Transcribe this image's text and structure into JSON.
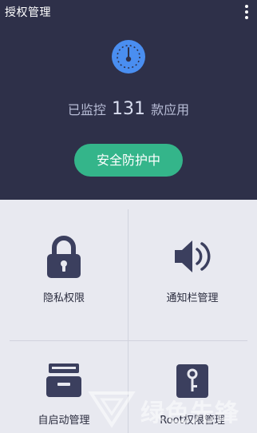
{
  "header": {
    "title": "授权管理",
    "menu_icon": "more-vert-icon"
  },
  "summary": {
    "prefix": "已监控",
    "count": "131",
    "suffix": "款应用",
    "gauge_icon": "gauge-icon",
    "gauge_color": "#4a8ef0"
  },
  "status_button": {
    "label": "安全防护中",
    "color": "#34b58a"
  },
  "tiles": [
    {
      "label": "隐私权限",
      "icon": "lock-icon"
    },
    {
      "label": "通知栏管理",
      "icon": "speaker-icon"
    },
    {
      "label": "自启动管理",
      "icon": "drawer-icon"
    },
    {
      "label": "Root权限管理",
      "icon": "key-doc-icon"
    }
  ],
  "watermark": {
    "text": "绿色先锋"
  },
  "colors": {
    "header_bg": "#2e3049",
    "body_bg": "#e8e9f0",
    "icon_color": "#3b3f5e"
  }
}
